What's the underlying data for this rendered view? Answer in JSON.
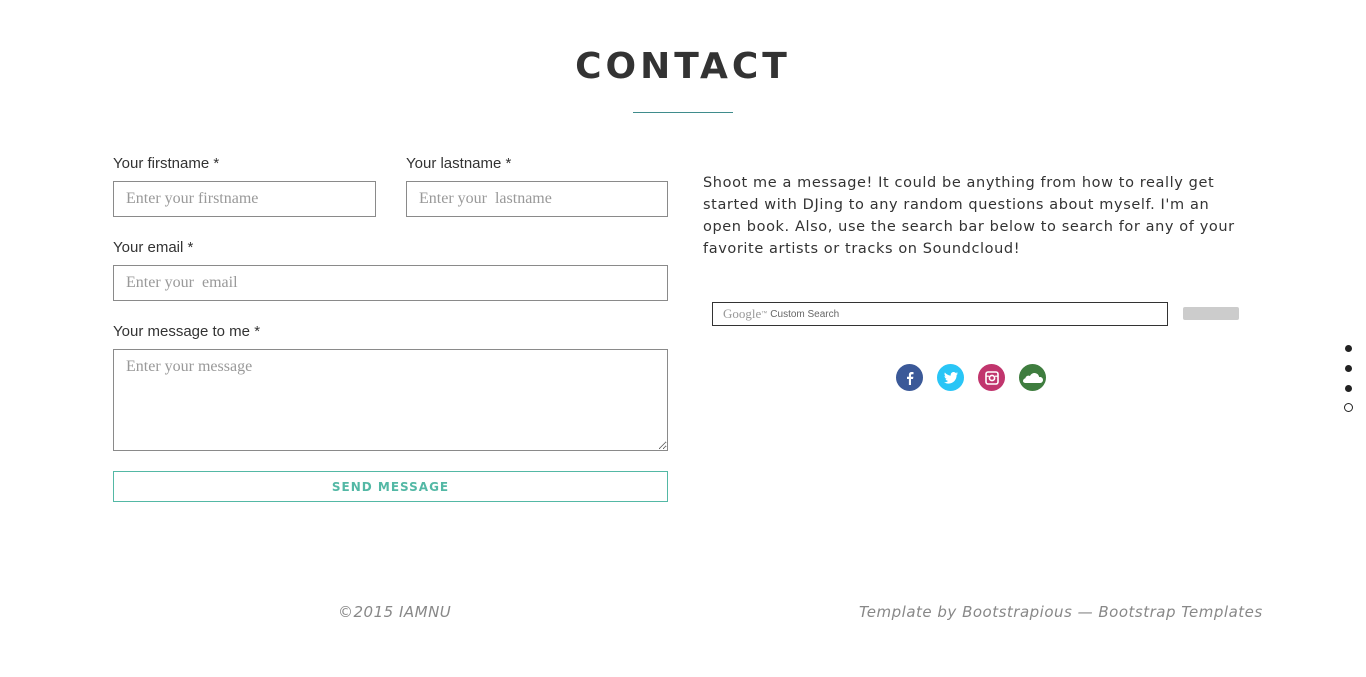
{
  "header": {
    "title": "CONTACT"
  },
  "form": {
    "firstname": {
      "label": "Your firstname *",
      "placeholder": "Enter your firstname"
    },
    "lastname": {
      "label": "Your lastname *",
      "placeholder": "Enter your  lastname"
    },
    "email": {
      "label": "Your email *",
      "placeholder": "Enter your  email"
    },
    "message": {
      "label": "Your message to me *",
      "placeholder": "Enter your message"
    },
    "submit_label": "SEND MESSAGE"
  },
  "intro": "Shoot me a message! It could be anything from how to really get started with DJing to any random questions about myself. I'm an open book. Also, use the search bar below to search for any of your favorite artists or tracks on Soundcloud!",
  "search": {
    "brand": "Google",
    "trademark": "™",
    "caption": "Custom Search"
  },
  "social": [
    {
      "icon": "facebook-icon",
      "color": "#3b5998"
    },
    {
      "icon": "twitter-icon",
      "color": "#29c5f6"
    },
    {
      "icon": "instagram-icon",
      "color": "#c1356d"
    },
    {
      "icon": "soundcloud-icon",
      "color": "#3f7d3f"
    }
  ],
  "footer": {
    "copyright": "©2015 IAMNU",
    "credit": "Template by Bootstrapious — Bootstrap Templates"
  },
  "colors": {
    "accent": "#53b8a5",
    "rule": "#3f8c8c"
  }
}
